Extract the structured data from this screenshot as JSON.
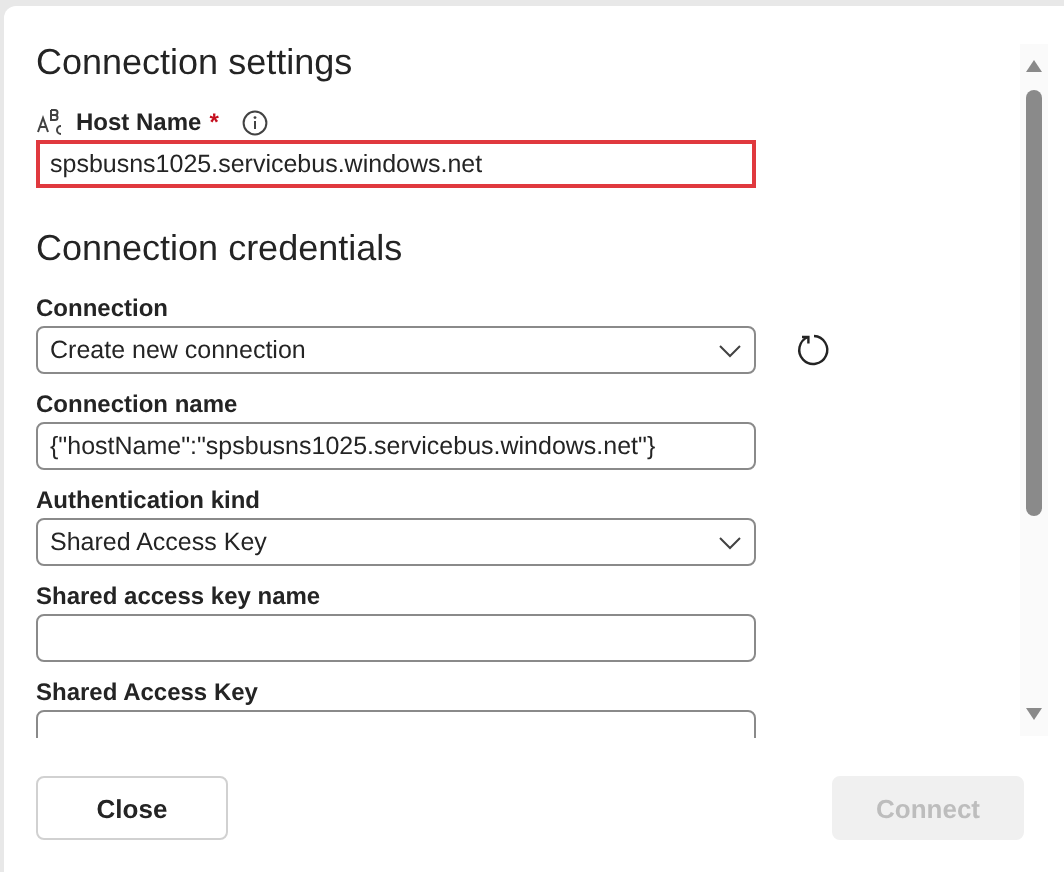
{
  "sections": [
    {
      "title": "Connection settings",
      "fields": [
        {
          "kind": "text",
          "label": "Host Name",
          "required_mark": "*",
          "highlighted": true,
          "value": "spsbusns1025.servicebus.windows.net"
        }
      ]
    },
    {
      "title": "Connection credentials",
      "fields": [
        {
          "kind": "dropdown",
          "label": "Connection",
          "highlighted": false,
          "value": "Create new connection",
          "refresh": true
        },
        {
          "kind": "text",
          "label": "Connection name",
          "highlighted": false,
          "value": "{\"hostName\":\"spsbusns1025.servicebus.windows.net\"}"
        },
        {
          "kind": "dropdown",
          "label": "Authentication kind",
          "highlighted": false,
          "value": "Shared Access Key"
        },
        {
          "kind": "text",
          "label": "Shared access key name",
          "highlighted": false
        },
        {
          "kind": "text",
          "label": "Shared Access Key",
          "highlighted": false
        }
      ]
    }
  ],
  "buttons": [
    {
      "label": "Close",
      "disabled": false
    },
    {
      "label": "Connect",
      "disabled": true
    }
  ]
}
